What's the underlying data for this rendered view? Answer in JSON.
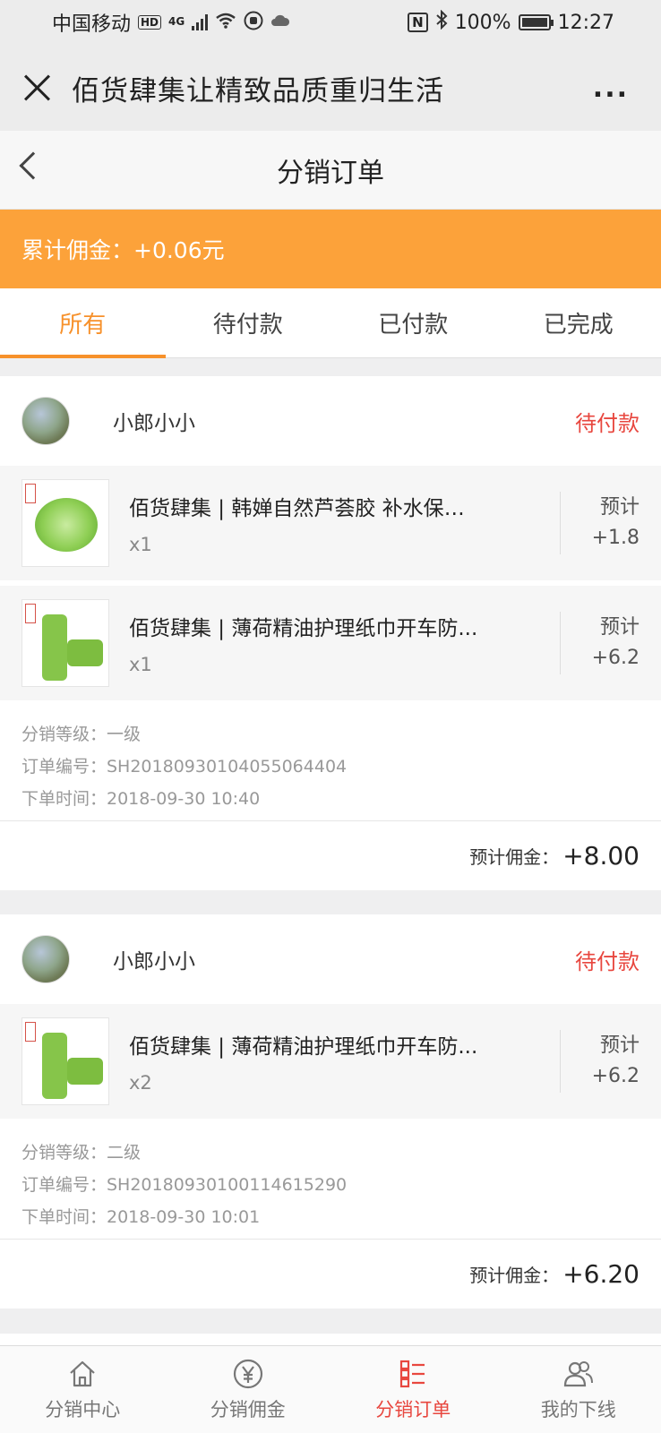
{
  "status_bar": {
    "carrier": "中国移动",
    "hd": "HD",
    "network": "4G",
    "nfc": "N",
    "battery": "100%",
    "time": "12:27"
  },
  "titlebar": {
    "title": "佰货肆集让精致品质重归生活",
    "more": "..."
  },
  "page": {
    "title": "分销订单"
  },
  "banner": {
    "text": "累计佣金：+0.06元"
  },
  "tabs": [
    {
      "label": "所有"
    },
    {
      "label": "待付款"
    },
    {
      "label": "已付款"
    },
    {
      "label": "已完成"
    }
  ],
  "orders": [
    {
      "user": "小郎小小",
      "status": "待付款",
      "items": [
        {
          "name": "佰货肆集 | 韩婵自然芦荟胶 补水保湿...",
          "qty": "x1",
          "est_label": "预计",
          "est_value": "+1.8"
        },
        {
          "name": "佰货肆集 | 薄荷精油护理纸巾开车防...",
          "qty": "x1",
          "est_label": "预计",
          "est_value": "+6.2"
        }
      ],
      "level": "分销等级：一级",
      "order_no": "订单编号：SH20180930104055064404",
      "time": "下单时间：2018-09-30 10:40",
      "commission_label": "预计佣金：",
      "commission_value": "+8.00"
    },
    {
      "user": "小郎小小",
      "status": "待付款",
      "items": [
        {
          "name": "佰货肆集 | 薄荷精油护理纸巾开车防...",
          "qty": "x2",
          "est_label": "预计",
          "est_value": "+6.2"
        }
      ],
      "level": "分销等级：二级",
      "order_no": "订单编号：SH20180930100114615290",
      "time": "下单时间：2018-09-30 10:01",
      "commission_label": "预计佣金：",
      "commission_value": "+6.20"
    }
  ],
  "bottom_nav": [
    {
      "label": "分销中心",
      "icon": "home-icon"
    },
    {
      "label": "分销佣金",
      "icon": "yen-icon"
    },
    {
      "label": "分销订单",
      "icon": "order-list-icon"
    },
    {
      "label": "我的下线",
      "icon": "users-icon"
    }
  ],
  "colors": {
    "accent_orange": "#fca23a",
    "tab_active": "#f7912b",
    "status_red": "#e8473f"
  }
}
